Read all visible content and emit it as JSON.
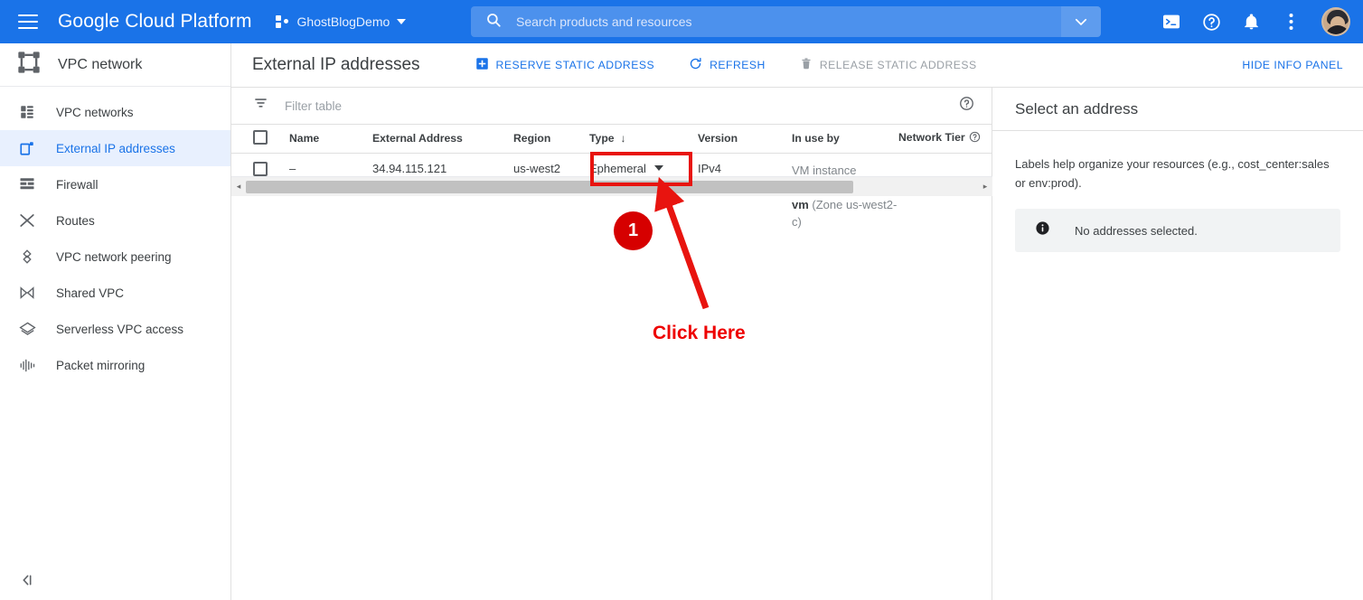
{
  "topbar": {
    "menu_icon": "hamburger-menu-icon",
    "brand": "Google Cloud Platform",
    "project_icon": "project-dots-icon",
    "project_name": "GhostBlogDemo",
    "project_caret": "chevron-down-icon",
    "search": {
      "icon": "search-icon",
      "placeholder": "Search products and resources",
      "value": "",
      "expand_icon": "chevron-down-icon"
    },
    "icons": [
      {
        "name": "cloud-shell-icon"
      },
      {
        "name": "help-icon"
      },
      {
        "name": "notifications-bell-icon"
      },
      {
        "name": "more-options-icon"
      }
    ],
    "avatar": "user-avatar",
    "bg_color": "#1a73e8"
  },
  "sidebar": {
    "header_icon": "vpc-network-icon",
    "header_title": "VPC network",
    "collapse_label": "◂|",
    "active_color": "#1a73e8",
    "active_bg": "#e8f0fe",
    "items": [
      {
        "label": "VPC networks",
        "icon": "vpc-networks-icon",
        "active": false
      },
      {
        "label": "External IP addresses",
        "icon": "external-ip-icon",
        "active": true
      },
      {
        "label": "Firewall",
        "icon": "firewall-icon",
        "active": false
      },
      {
        "label": "Routes",
        "icon": "routes-icon",
        "active": false
      },
      {
        "label": "VPC network peering",
        "icon": "peering-icon",
        "active": false
      },
      {
        "label": "Shared VPC",
        "icon": "shared-vpc-icon",
        "active": false
      },
      {
        "label": "Serverless VPC access",
        "icon": "serverless-vpc-icon",
        "active": false
      },
      {
        "label": "Packet mirroring",
        "icon": "packet-mirroring-icon",
        "active": false
      }
    ]
  },
  "content": {
    "page_title": "External IP addresses",
    "actions": [
      {
        "label": "RESERVE STATIC ADDRESS",
        "icon": "add-box-icon",
        "disabled": false
      },
      {
        "label": "REFRESH",
        "icon": "refresh-icon",
        "disabled": false
      },
      {
        "label": "RELEASE STATIC ADDRESS",
        "icon": "trash-icon",
        "disabled": true
      }
    ],
    "hide_info_panel": "HIDE INFO PANEL",
    "filter": {
      "icon": "filter-icon",
      "placeholder": "Filter table",
      "value": "",
      "help_icon": "help-circle-icon"
    },
    "table": {
      "select_all_checkbox": "unchecked",
      "columns": [
        {
          "label": "Name",
          "sorted": false
        },
        {
          "label": "External Address",
          "sorted": false
        },
        {
          "label": "Region",
          "sorted": false
        },
        {
          "label": "Type",
          "sorted": true,
          "sort_dir": "↓"
        },
        {
          "label": "Version",
          "sorted": false
        },
        {
          "label": "In use by",
          "sorted": false
        },
        {
          "label": "Network Tier",
          "sorted": false,
          "help_icon": "help-circle-icon"
        }
      ],
      "rows": [
        {
          "checked": false,
          "name": "–",
          "external_address": "34.94.115.121",
          "region": "us-west2",
          "type": "Ephemeral",
          "type_caret": "chevron-down-icon",
          "version": "IPv4",
          "in_use_by_prefix": "VM instance ",
          "in_use_by_resource": "ghostdemoblog-vm",
          "in_use_by_suffix": " (Zone us-west2-c)",
          "network_tier": ""
        }
      ]
    },
    "scrollbar": {
      "left_arrow": "◂",
      "right_arrow": "▸"
    }
  },
  "info_panel": {
    "title": "Select an address",
    "description": "Labels help organize your resources (e.g., cost_center:sales or env:prod).",
    "note_icon": "info-icon",
    "note_text": "No addresses selected."
  },
  "annotation": {
    "step_number": "1",
    "call_to_action": "Click Here",
    "color": "#e8140f",
    "badge_color": "#d60000"
  }
}
